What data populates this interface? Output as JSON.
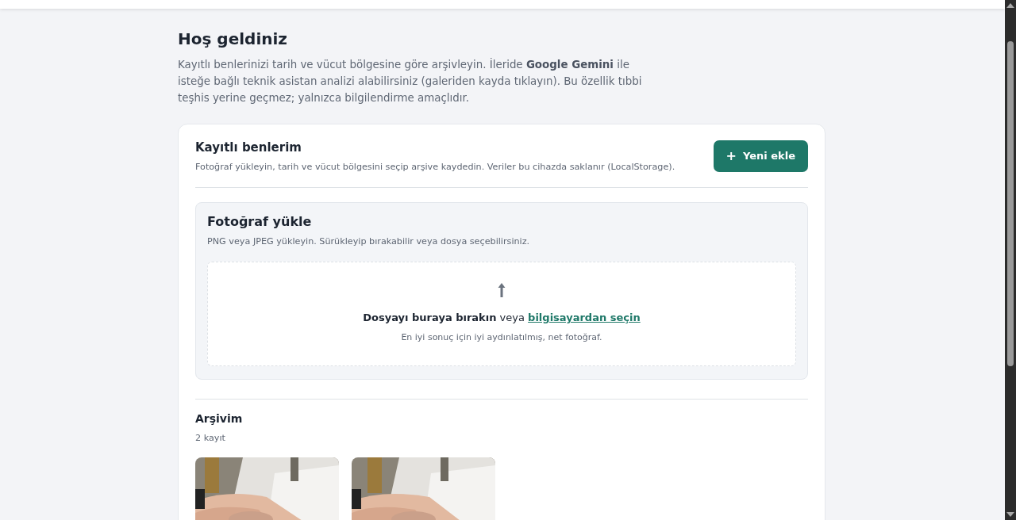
{
  "welcome": {
    "title": "Hoş geldiniz",
    "description": "Kayıtlı benlerinizi tarih ve vücut bölgesine göre arşivleyin. İleride **Google Gemini** ile isteğe bağlı teknik asistan analizi alabilirsiniz (galeriden kayda tıklayın). Bu özellik tıbbi teşhis yerine geçmez; yalnızca bilgilendirme amaçlıdır."
  },
  "card": {
    "title": "Kayıtlı benlerim",
    "subtitle": "Fotoğraf yükleyin, tarih ve vücut bölgesini seçip arşive kaydedin. Veriler bu cihazda saklanır (LocalStorage).",
    "add_button": {
      "icon": "+",
      "label": "Yeni ekle"
    },
    "upload": {
      "title": "Fotoğraf yükle",
      "hint": "PNG veya JPEG yükleyin. Sürükleyip bırakabilir veya dosya seçebilirsiniz.",
      "drop_text": "**Dosyayı buraya bırakın** veya",
      "drop_link": "bilgisayardan seçin",
      "drop_note": "En iyi sonuç için iyi aydınlatılmış, net fotoğraf."
    },
    "archive": {
      "title": "Arşivim",
      "count": "2 kayıt"
    }
  }
}
